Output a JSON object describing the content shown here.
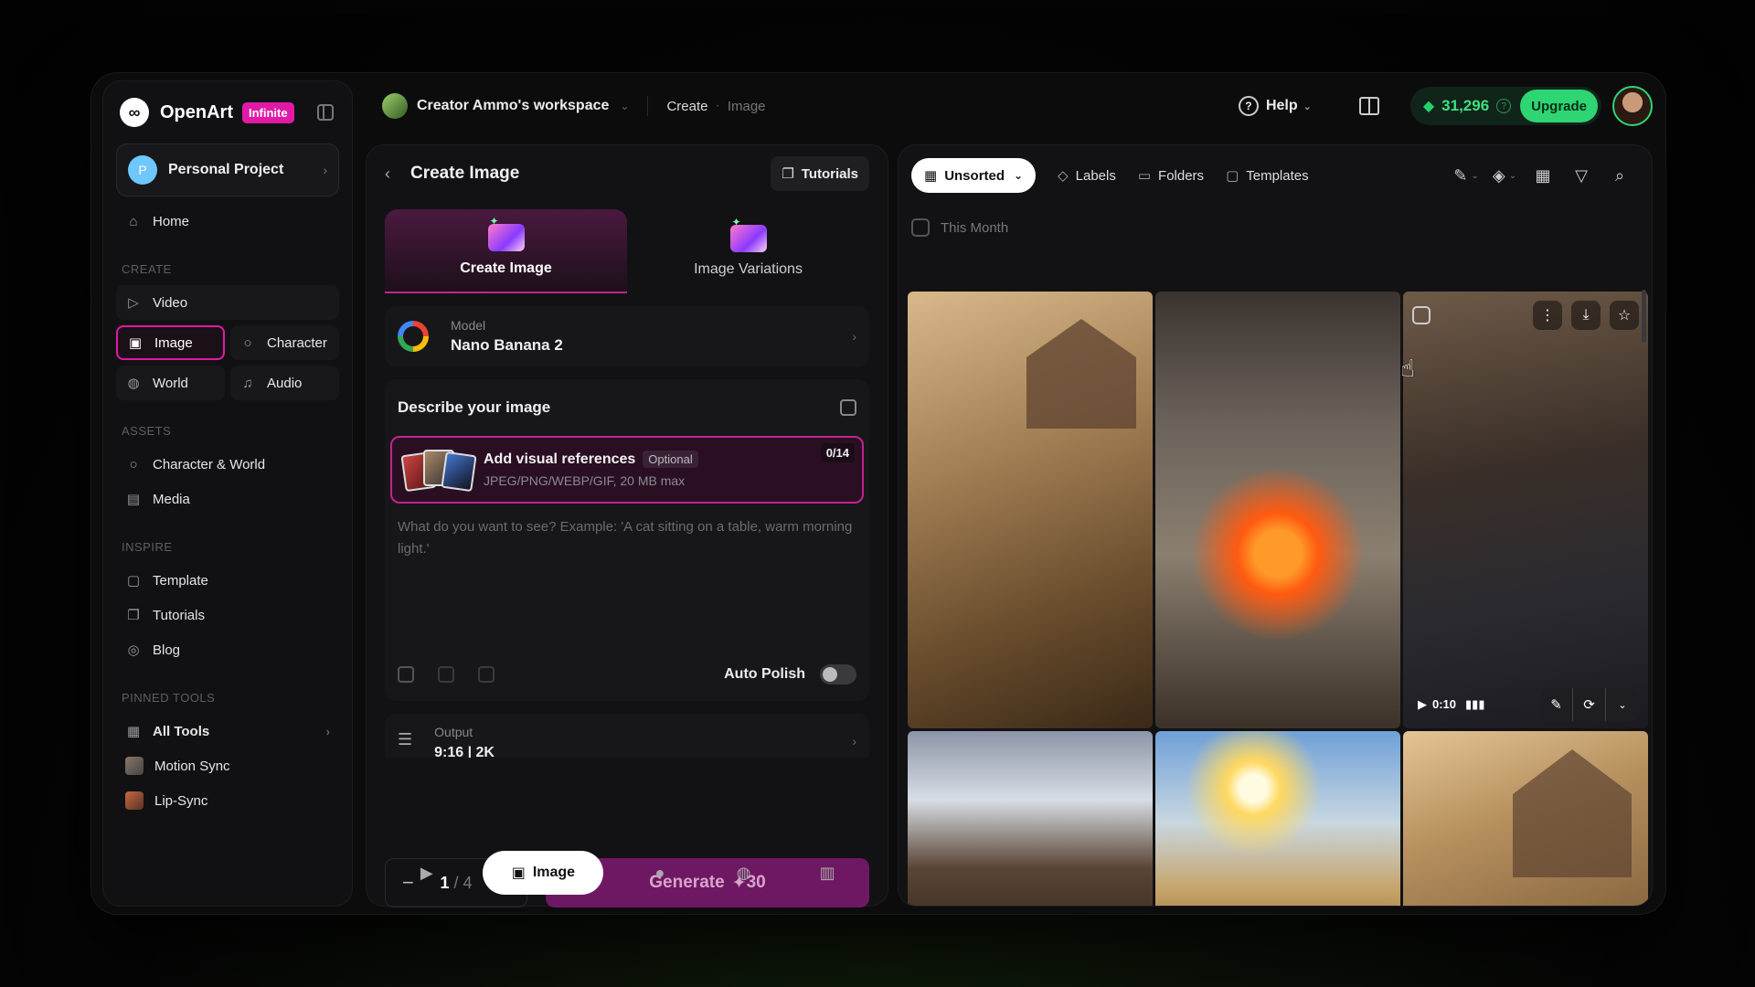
{
  "brand": {
    "name": "OpenArt",
    "badge": "Infinite"
  },
  "project": {
    "initial": "P",
    "name": "Personal Project"
  },
  "sidebar": {
    "home": "Home",
    "create_title": "CREATE",
    "create_items": [
      "Video",
      "Image",
      "Character",
      "World",
      "Audio"
    ],
    "assets_title": "ASSETS",
    "assets_items": [
      "Character & World",
      "Media"
    ],
    "inspire_title": "INSPIRE",
    "inspire_items": [
      "Template",
      "Tutorials",
      "Blog"
    ],
    "pinned_title": "PINNED TOOLS",
    "pinned_items": [
      "All Tools",
      "Motion Sync",
      "Lip-Sync"
    ]
  },
  "topbar": {
    "workspace": "Creator Ammo's workspace",
    "crumb_1": "Create",
    "crumb_2": "Image",
    "help": "Help",
    "credits": "31,296",
    "upgrade": "Upgrade"
  },
  "create_panel": {
    "title": "Create Image",
    "tutorials": "Tutorials",
    "mode_active": "Create Image",
    "mode_other": "Image Variations",
    "model_label": "Model",
    "model_value": "Nano Banana 2",
    "describe_title": "Describe your image",
    "refs_title": "Add visual references",
    "refs_optional": "Optional",
    "refs_formats": "JPEG/PNG/WEBP/GIF, 20 MB max",
    "refs_count": "0/14",
    "prompt_placeholder": "What do you want to see? Example: 'A cat sitting on a table, warm morning light.'",
    "auto_polish": "Auto Polish",
    "output_label": "Output",
    "output_value": "9:16 | 2K",
    "count_current": "1",
    "count_total": "/ 4",
    "generate": "Generate",
    "generate_cost": "30",
    "bottom_active": "Image"
  },
  "gallery": {
    "sort": "Unsorted",
    "labels": "Labels",
    "folders": "Folders",
    "templates": "Templates",
    "section": "This Month",
    "video_duration": "0:10"
  }
}
